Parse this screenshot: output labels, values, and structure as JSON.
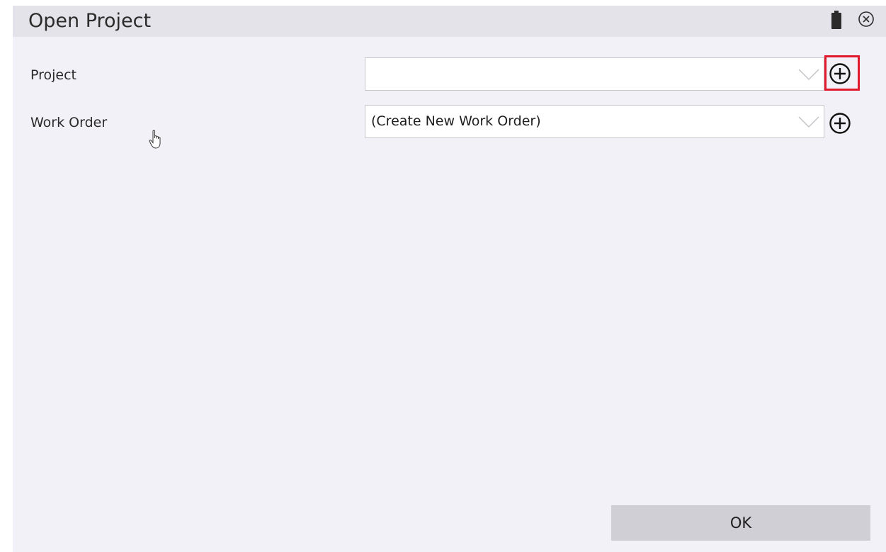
{
  "dialog": {
    "title": "Open Project",
    "title_icons": [
      "battery-icon",
      "close-circle-icon"
    ]
  },
  "fields": {
    "project": {
      "label": "Project",
      "value": "",
      "add_icon": "plus-circle-icon"
    },
    "work_order": {
      "label": "Work Order",
      "value": "(Create New Work Order)",
      "add_icon": "plus-circle-icon"
    }
  },
  "footer": {
    "ok_label": "OK"
  },
  "colors": {
    "dialog_background": "#f2f1f7",
    "titlebar_background": "#e4e3e9",
    "highlight": "#e0192d",
    "button_background": "#d0cfd6"
  }
}
